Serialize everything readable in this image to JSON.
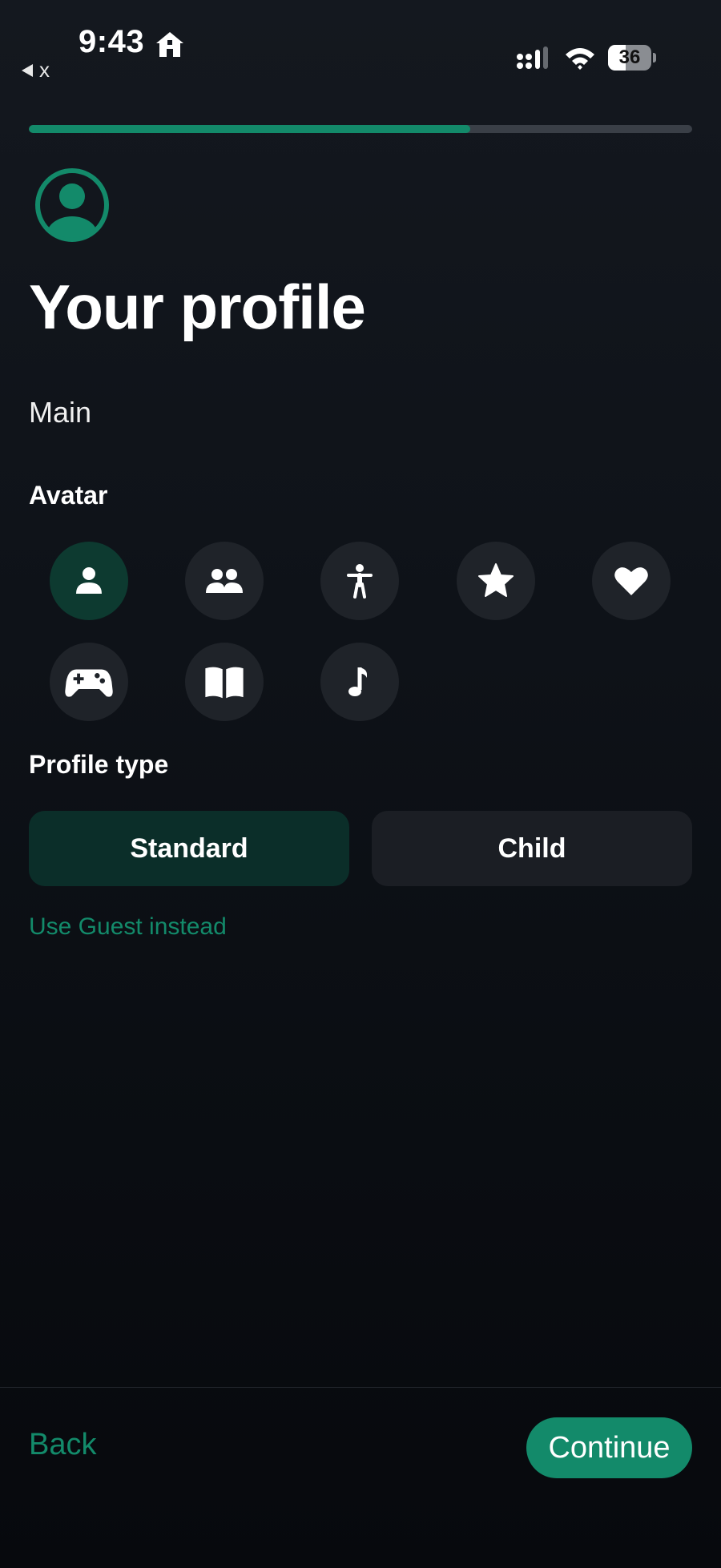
{
  "status_bar": {
    "time": "9:43",
    "back_app": "x",
    "battery": "36"
  },
  "progress": {
    "fraction": 0.665,
    "color": "#138a6a"
  },
  "screen": {
    "title": "Your profile",
    "profile_name": "Main",
    "avatar_label": "Avatar",
    "profile_type_label": "Profile type",
    "avatars": [
      {
        "icon": "person-icon",
        "selected": true
      },
      {
        "icon": "people-icon",
        "selected": false
      },
      {
        "icon": "figure-icon",
        "selected": false
      },
      {
        "icon": "star-icon",
        "selected": false
      },
      {
        "icon": "heart-icon",
        "selected": false
      },
      {
        "icon": "gamepad-icon",
        "selected": false
      },
      {
        "icon": "book-icon",
        "selected": false
      },
      {
        "icon": "music-note-icon",
        "selected": false
      }
    ],
    "profile_types": {
      "standard": "Standard",
      "child": "Child",
      "selected": "Standard"
    },
    "guest_link": "Use Guest instead"
  },
  "footer": {
    "back": "Back",
    "continue": "Continue"
  },
  "colors": {
    "accent": "#138a6a",
    "background": "#0e1218"
  }
}
